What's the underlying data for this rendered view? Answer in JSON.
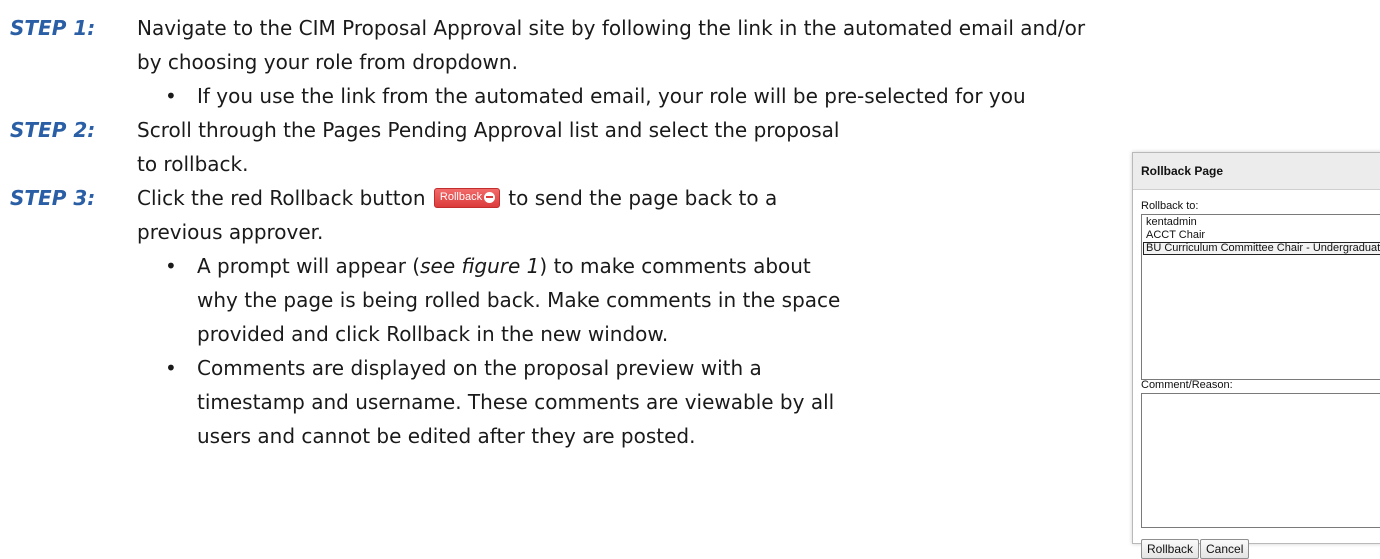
{
  "steps": [
    {
      "label": "STEP 1:",
      "lines": [
        "Navigate to the CIM Proposal Approval site by following the link in the automated email and/or",
        "by choosing your role from dropdown."
      ],
      "bullets": [
        [
          "If you use the link from the automated email, your role will be pre-selected for you"
        ]
      ]
    },
    {
      "label": "STEP 2:",
      "lines": [
        "Scroll through the Pages Pending Approval list and select the proposal",
        "to rollback."
      ]
    },
    {
      "label": "STEP 3:",
      "line1_before": "Click the red Rollback button",
      "line1_after": "to send the page back to a",
      "line2": "previous approver.",
      "inline_button_label": "Rollback",
      "bullet1": {
        "l1_before": "A prompt will appear (",
        "l1_em": "see figure 1",
        "l1_after": ") to make comments about",
        "l2": "why the page is being rolled back. Make comments in the space",
        "l3": "provided and click Rollback in the new window."
      },
      "bullet2": [
        "Comments are displayed on the proposal preview with a",
        "timestamp and username. These comments are viewable by all",
        "users and cannot be edited after they are posted."
      ]
    }
  ],
  "bullet_glyph": "•",
  "dialog": {
    "title": "Rollback Page",
    "rollback_to_label": "Rollback to:",
    "options": [
      "kentadmin",
      "ACCT Chair",
      "BU Curriculum Committee Chair - Undergraduate"
    ],
    "selected_option": "BU Curriculum Committee Chair - Undergraduate",
    "comment_label": "Comment/Reason:",
    "rollback_button": "Rollback",
    "cancel_button": "Cancel"
  },
  "colors": {
    "step_label": "#2a5ea5",
    "rollback_button": "#dc3b3b"
  }
}
